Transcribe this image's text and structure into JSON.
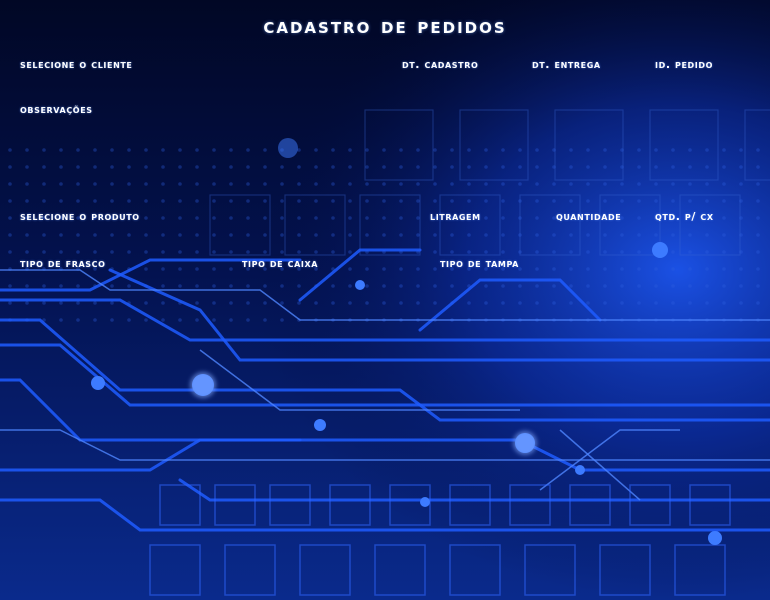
{
  "form": {
    "title": "CADASTRO DE PEDIDOS",
    "labels": {
      "cliente": "SELECIONE O CLIENTE",
      "dt_cadastro": "DT. CADASTRO",
      "dt_entrega": "DT. ENTREGA",
      "id_pedido": "ID. PEDIDO",
      "observacoes": "OBSERVAÇÕES",
      "produto": "SELECIONE O PRODUTO",
      "litragem": "LITRAGEM",
      "quantidade": "QUANTIDADE",
      "qtd_cx": "QTD. P/ CX",
      "tipo_frasco": "TIPO DE FRASCO",
      "tipo_caixa": "TIPO DE CAIXA",
      "tipo_tampa": "TIPO DE TAMPA"
    }
  },
  "colors": {
    "background_dark": "#020a3a",
    "circuit_blue": "#1e5cff",
    "glow_blue": "#4f86ff",
    "label_text": "#ffffff"
  },
  "background": {
    "icon": "circuit-board-background"
  }
}
